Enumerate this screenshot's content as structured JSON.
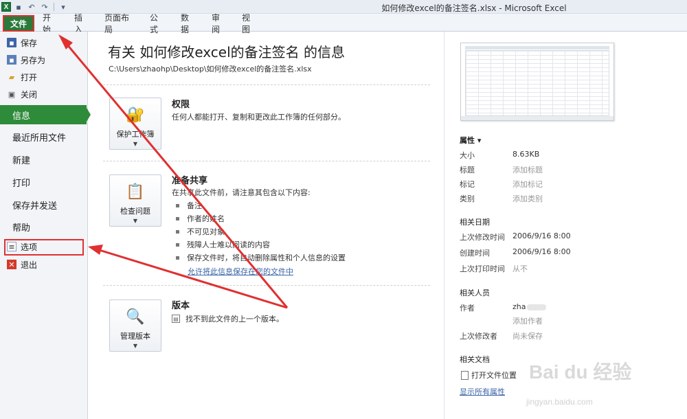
{
  "window": {
    "title": "如何修改excel的备注签名.xlsx - Microsoft Excel"
  },
  "qat": {
    "logo": "X",
    "save_icon": "save-icon",
    "undo": "↶",
    "redo": "↷",
    "customize": "▾"
  },
  "ribbon": {
    "file_tab": "文件",
    "tabs": [
      "开始",
      "插入",
      "页面布局",
      "公式",
      "数据",
      "审阅",
      "视图"
    ]
  },
  "nav": {
    "save": "保存",
    "save_as": "另存为",
    "open": "打开",
    "close": "关闭",
    "info": "信息",
    "recent": "最近所用文件",
    "new": "新建",
    "print": "打印",
    "save_send": "保存并发送",
    "help": "帮助",
    "options": "选项",
    "exit": "退出"
  },
  "main": {
    "title": "有关 如何修改excel的备注签名 的信息",
    "path": "C:\\Users\\zhaohp\\Desktop\\如何修改excel的备注签名.xlsx",
    "permissions": {
      "button": "保护工作簿",
      "title": "权限",
      "desc": "任何人都能打开、复制和更改此工作簿的任何部分。"
    },
    "share": {
      "button": "检查问题",
      "title": "准备共享",
      "desc": "在共享此文件前，请注意其包含以下内容:",
      "items": [
        "备注",
        "作者的姓名",
        "不可见对象",
        "残障人士难以阅读的内容",
        "保存文件时，将自动删除属性和个人信息的设置"
      ],
      "link": "允许将此信息保存在您的文件中"
    },
    "versions": {
      "button": "管理版本",
      "title": "版本",
      "desc": "找不到此文件的上一个版本。"
    }
  },
  "properties": {
    "header": "属性 ▾",
    "size_label": "大小",
    "size_value": "8.63KB",
    "title_label": "标题",
    "title_value": "添加标题",
    "tags_label": "标记",
    "tags_value": "添加标记",
    "category_label": "类别",
    "category_value": "添加类别",
    "dates_header": "相关日期",
    "modified_label": "上次修改时间",
    "modified_value": "2006/9/16 8:00",
    "created_label": "创建时间",
    "created_value": "2006/9/16 8:00",
    "printed_label": "上次打印时间",
    "printed_value": "从不",
    "people_header": "相关人员",
    "author_label": "作者",
    "author_value": "zha",
    "add_author": "添加作者",
    "last_modified_by_label": "上次修改者",
    "last_modified_by_value": "尚未保存",
    "docs_header": "相关文档",
    "open_location": "打开文件位置",
    "show_all": "显示所有属性"
  },
  "watermark": {
    "main": "Bai du 经验",
    "sub": "jingyan.baidu.com"
  },
  "colors": {
    "accent_green": "#2e8b3a",
    "annotation_red": "#e03030",
    "link_blue": "#3963a6"
  }
}
